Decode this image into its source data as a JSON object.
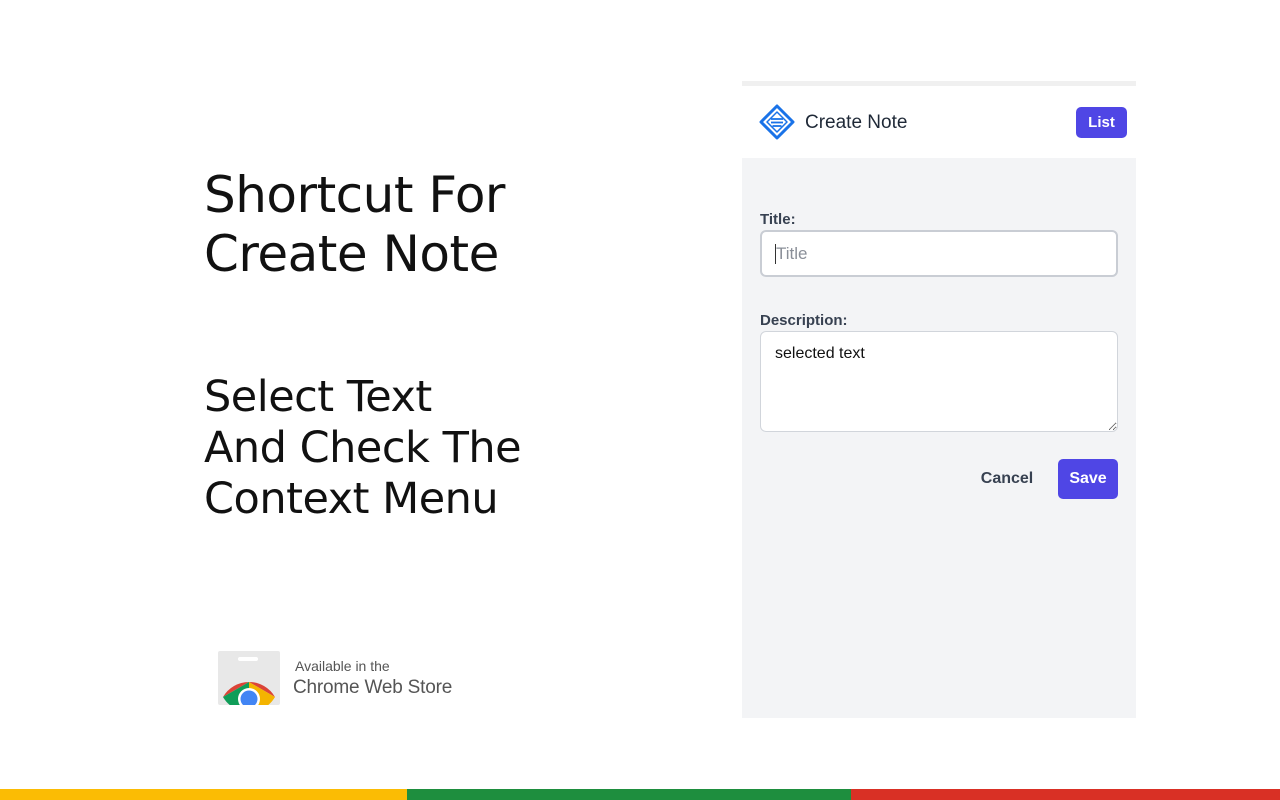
{
  "promo": {
    "headline": [
      "Shortcut For",
      "Create Note"
    ],
    "subline": [
      "Select Text",
      "And Check The",
      "Context Menu"
    ]
  },
  "store_badge": {
    "line1": "Available in the",
    "line2": "Chrome Web Store",
    "icon": "chrome-web-store-icon"
  },
  "popup": {
    "header": {
      "logo_icon": "note-diamond-icon",
      "title": "Create Note",
      "list_label": "List"
    },
    "form": {
      "title_label": "Title:",
      "title_placeholder": "Title",
      "title_value": "",
      "description_label": "Description:",
      "description_value": "selected text",
      "cancel_label": "Cancel",
      "save_label": "Save"
    }
  },
  "colors": {
    "accent": "#4f46e5",
    "logo_blue": "#1a73e8",
    "panel_bg": "#f3f4f6",
    "bar_yellow": "#fbbc04",
    "bar_green": "#1e8e3e",
    "bar_red": "#d93025"
  }
}
